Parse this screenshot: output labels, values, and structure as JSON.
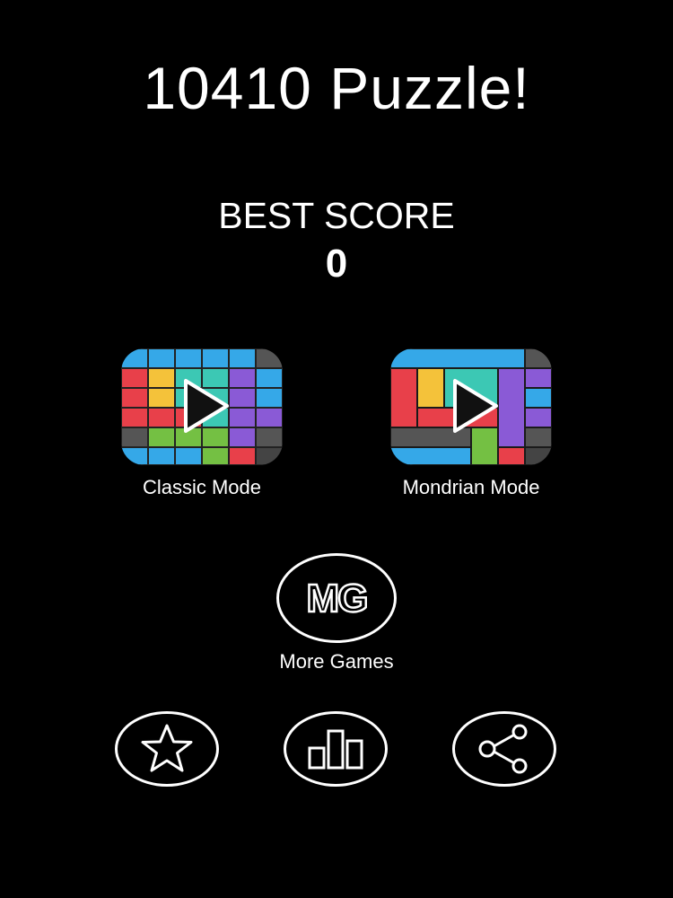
{
  "title": "10410 Puzzle!",
  "best_score": {
    "label": "BEST SCORE",
    "value": "0"
  },
  "modes": [
    {
      "label": "Classic Mode",
      "icon": "classic-mode-play-icon"
    },
    {
      "label": "Mondrian Mode",
      "icon": "mondrian-mode-play-icon"
    }
  ],
  "more_games": {
    "logo_text": "MG",
    "label": "More Games"
  },
  "bottom_buttons": [
    {
      "icon": "star-icon"
    },
    {
      "icon": "leaderboard-icon"
    },
    {
      "icon": "share-icon"
    }
  ],
  "colors": {
    "background": "#000000",
    "foreground": "#ffffff",
    "block_red": "#e8404a",
    "block_blue": "#35a8e8",
    "block_teal": "#3cc8b4",
    "block_yellow": "#f4c23a",
    "block_green": "#74c043",
    "block_purple": "#8a5ad6"
  }
}
